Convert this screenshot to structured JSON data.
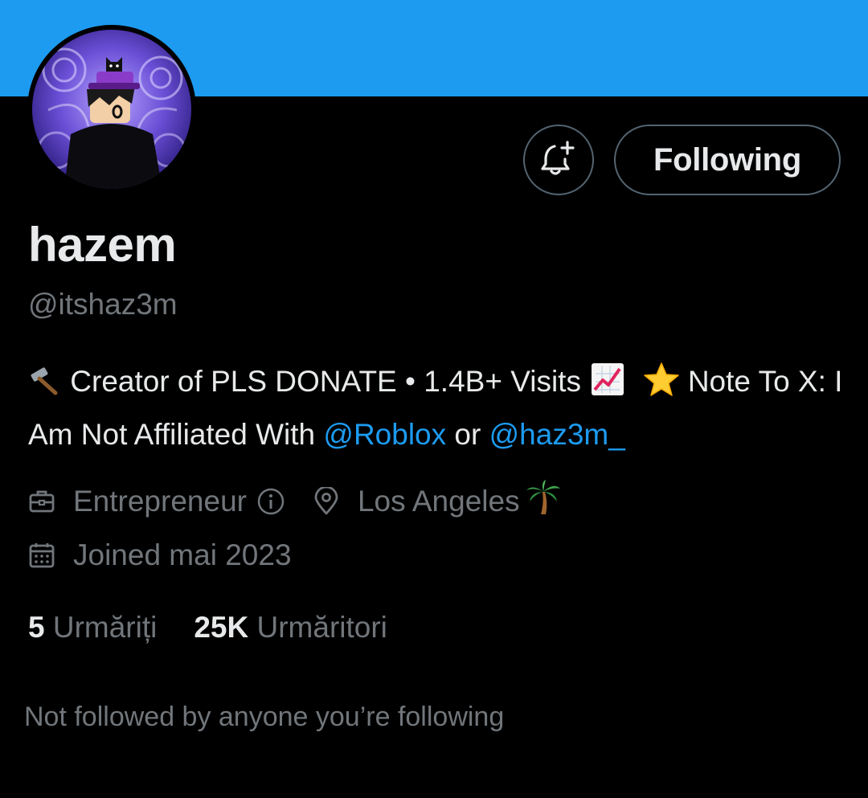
{
  "profile": {
    "display_name": "hazem",
    "handle": "@itshaz3m",
    "avatar_icon": "roblox-avatar-image"
  },
  "actions": {
    "notify_icon": "bell-plus-icon",
    "following_label": "Following"
  },
  "bio": {
    "hammer_emoji": "🔨",
    "text_part1": "Creator of PLS DONATE • 1.4B+ Visits",
    "chart_emoji": "📈",
    "star_emoji": "⭐",
    "text_part2": "Note To X: I Am Not Affiliated With",
    "mention1": "@Roblox",
    "text_or": "or",
    "mention2": "@haz3m_"
  },
  "meta": {
    "category": "Entrepreneur",
    "location": "Los Angeles",
    "location_emoji": "🌴",
    "joined": "Joined mai 2023"
  },
  "stats": {
    "following_count": "5",
    "following_label": "Urmăriți",
    "followers_count": "25K",
    "followers_label": "Urmăritori"
  },
  "social_context": "Not followed by anyone you’re following",
  "colors": {
    "banner": "#1d9bf0",
    "link": "#1d9bf0",
    "secondary_text": "#71767b",
    "primary_text": "#e7e9ea",
    "border": "#536471",
    "background": "#000000"
  }
}
